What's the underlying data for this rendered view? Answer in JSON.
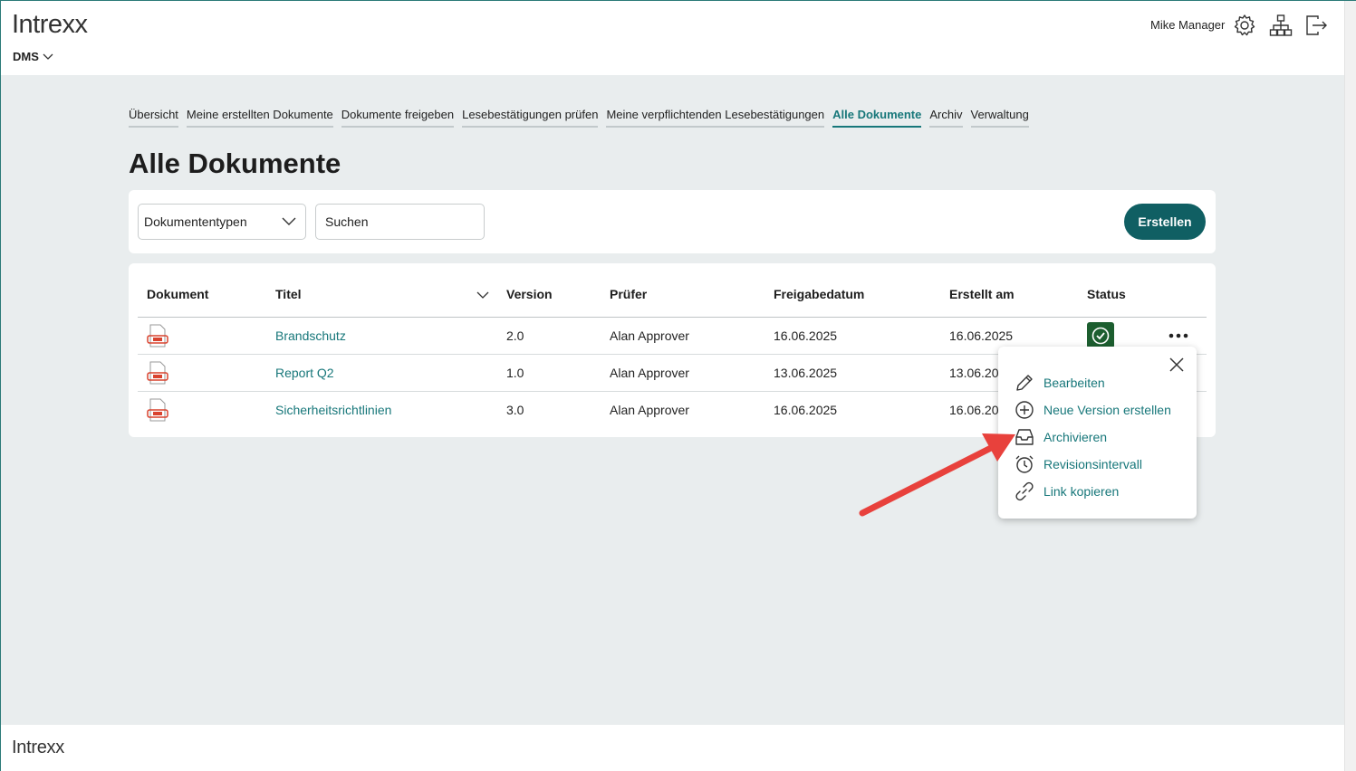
{
  "header": {
    "logo": "Intrexx",
    "app_switch": "DMS",
    "user_name": "Mike Manager"
  },
  "tabs": [
    {
      "label": "Übersicht",
      "active": false
    },
    {
      "label": "Meine erstellten Dokumente",
      "active": false
    },
    {
      "label": "Dokumente freigeben",
      "active": false
    },
    {
      "label": "Lesebestätigungen prüfen",
      "active": false
    },
    {
      "label": "Meine verpflichtenden Lesebestätigungen",
      "active": false
    },
    {
      "label": "Alle Dokumente",
      "active": true
    },
    {
      "label": "Archiv",
      "active": false
    },
    {
      "label": "Verwaltung",
      "active": false
    }
  ],
  "page_title": "Alle Dokumente",
  "toolbar": {
    "doc_type_select": "Dokumententypen",
    "search_placeholder": "Suchen",
    "create_label": "Erstellen"
  },
  "table": {
    "columns": [
      "Dokument",
      "Titel",
      "Version",
      "Prüfer",
      "Freigabedatum",
      "Erstellt am",
      "Status"
    ],
    "rows": [
      {
        "title": "Brandschutz",
        "version": "2.0",
        "reviewer": "Alan Approver",
        "approval_date": "16.06.2025",
        "created": "16.06.2025"
      },
      {
        "title": "Report Q2",
        "version": "1.0",
        "reviewer": "Alan Approver",
        "approval_date": "13.06.2025",
        "created": "13.06.20"
      },
      {
        "title": "Sicherheitsrichtlinien",
        "version": "3.0",
        "reviewer": "Alan Approver",
        "approval_date": "16.06.2025",
        "created": "16.06.20"
      }
    ]
  },
  "context_menu": {
    "items": [
      "Bearbeiten",
      "Neue Version erstellen",
      "Archivieren",
      "Revisionsintervall",
      "Link kopieren"
    ]
  },
  "footer": {
    "logo": "Intrexx"
  },
  "colors": {
    "accent": "#17777a",
    "button": "#105f63",
    "status_ok": "#1c5e2f",
    "annotation_arrow": "#e8413c"
  }
}
